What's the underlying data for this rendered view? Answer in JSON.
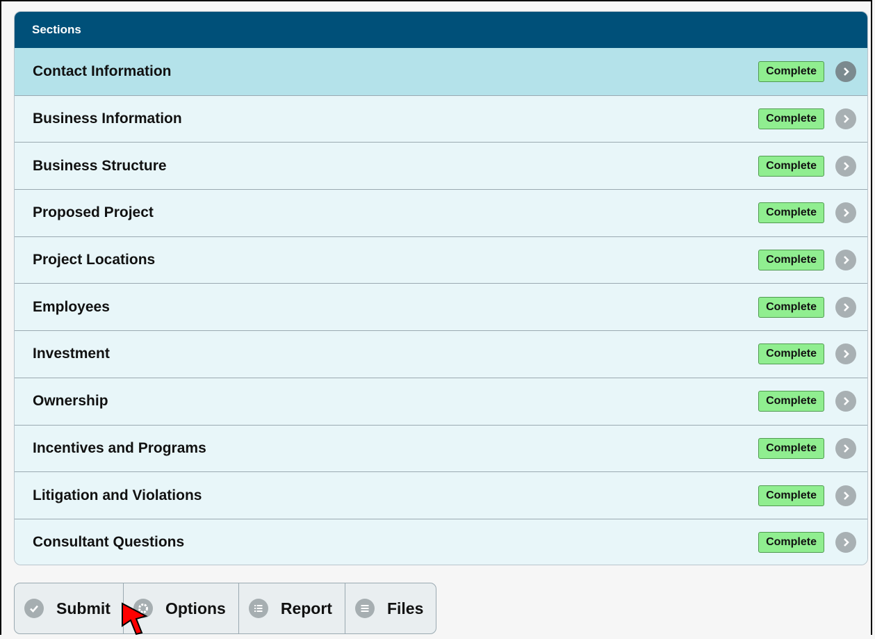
{
  "sections": {
    "header": "Sections",
    "items": [
      {
        "label": "Contact Information",
        "status": "Complete"
      },
      {
        "label": "Business Information",
        "status": "Complete"
      },
      {
        "label": "Business Structure",
        "status": "Complete"
      },
      {
        "label": "Proposed Project",
        "status": "Complete"
      },
      {
        "label": "Project Locations",
        "status": "Complete"
      },
      {
        "label": "Employees",
        "status": "Complete"
      },
      {
        "label": "Investment",
        "status": "Complete"
      },
      {
        "label": "Ownership",
        "status": "Complete"
      },
      {
        "label": "Incentives and Programs",
        "status": "Complete"
      },
      {
        "label": "Litigation and Violations",
        "status": "Complete"
      },
      {
        "label": "Consultant Questions",
        "status": "Complete"
      }
    ]
  },
  "toolbar": {
    "submit_label": "Submit",
    "options_label": "Options",
    "report_label": "Report",
    "files_label": "Files"
  },
  "colors": {
    "header_bg": "#005079",
    "selected_row_bg": "#b4e2ea",
    "row_bg": "#e8f6f9",
    "complete_badge": "#90ee90",
    "pointer": "#ff0000"
  },
  "icons": {
    "row_action": "chevron-right-icon",
    "submit": "checkmark-icon",
    "options": "gear-icon",
    "report": "list-icon",
    "files": "menu-lines-icon"
  }
}
